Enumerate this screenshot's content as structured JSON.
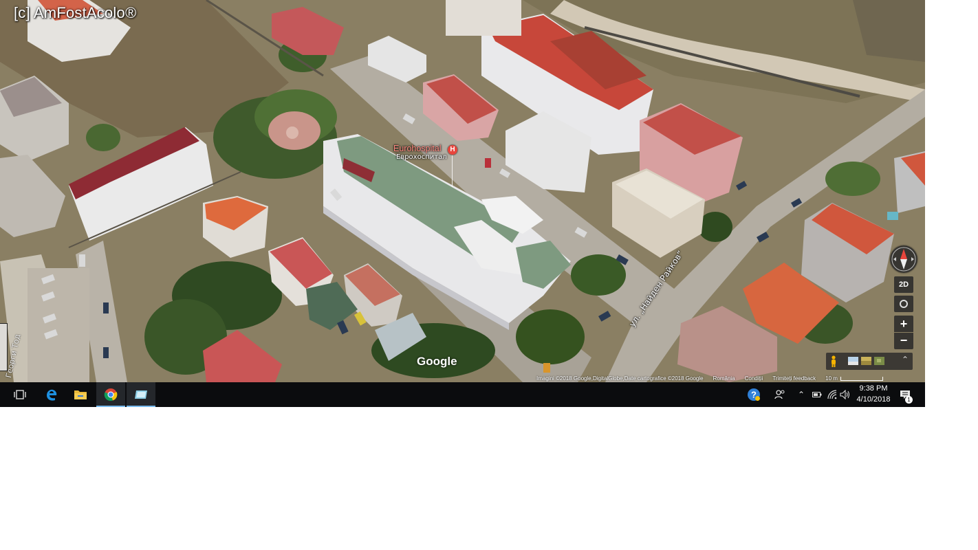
{
  "watermark": "[c] AmFostAcolo®",
  "map": {
    "poi": {
      "name": "Eurohospital",
      "subtitle": "Еврохоспитал",
      "marker_letter": "H"
    },
    "street_label": "ул. „Найден Райков“",
    "left_street_label": "Георги Тод",
    "google_logo": "Google",
    "controls": {
      "view_toggle": "2D",
      "zoom_in": "+",
      "zoom_out": "−"
    },
    "attribution": {
      "imagery": "Imagini ©2018 Google,DigitalGlobe,Date cartografice ©2018 Google",
      "country": "România",
      "terms": "Condiții",
      "feedback": "Trimiteți feedback",
      "scale": "10 m"
    }
  },
  "taskbar": {
    "clock_time": "9:38 PM",
    "clock_date": "4/10/2018",
    "notification_count": "1",
    "pinned": [
      "task-view",
      "edge",
      "file-explorer",
      "chrome",
      "app"
    ]
  },
  "colors": {
    "taskbar": "#0b0c0e",
    "poi_red": "#e8453c",
    "active_underline": "#76b9ed"
  }
}
